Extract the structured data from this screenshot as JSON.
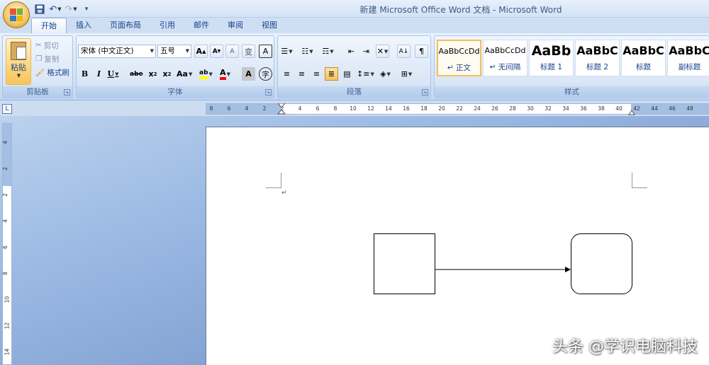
{
  "window": {
    "title": "新建 Microsoft Office Word 文档 - Microsoft Word"
  },
  "quick_access": {
    "icons": [
      "save-icon",
      "undo-icon",
      "redo-icon",
      "customize-icon"
    ]
  },
  "tabs": [
    {
      "label": "开始",
      "active": true
    },
    {
      "label": "插入"
    },
    {
      "label": "页面布局"
    },
    {
      "label": "引用"
    },
    {
      "label": "邮件"
    },
    {
      "label": "审阅"
    },
    {
      "label": "视图"
    }
  ],
  "clipboard": {
    "paste_label": "粘贴",
    "cut_label": "剪切",
    "copy_label": "复制",
    "format_painter_label": "格式刷",
    "group_label": "剪贴板"
  },
  "font": {
    "font_name": "宋体 (中文正文)",
    "font_size": "五号",
    "group_label": "字体",
    "buttons": {
      "grow": "A",
      "shrink": "A",
      "clear": "A",
      "phonetic": "变",
      "border": "A",
      "bold": "B",
      "italic": "I",
      "underline": "U",
      "strike": "abe",
      "subscript": "x",
      "superscript": "x",
      "case": "Aa",
      "highlight": "ab",
      "color": "A",
      "shading": "A",
      "enclose": "字"
    },
    "highlight_color": "#ffff00",
    "font_color": "#ff0000"
  },
  "paragraph": {
    "group_label": "段落"
  },
  "styles": {
    "group_label": "样式",
    "items": [
      {
        "sample": "AaBbCcDd",
        "name": "↵ 正文",
        "selected": true
      },
      {
        "sample": "AaBbCcDd",
        "name": "↵ 无间隔"
      },
      {
        "sample": "AaBb",
        "name": "标题 1"
      },
      {
        "sample": "AaBbC",
        "name": "标题 2"
      },
      {
        "sample": "AaBbC",
        "name": "标题"
      },
      {
        "sample": "AaBbC",
        "name": "副标题"
      }
    ]
  },
  "ruler": {
    "corner": "L",
    "h_ticks": [
      "8",
      "6",
      "4",
      "2",
      "2",
      "4",
      "6",
      "8",
      "10",
      "12",
      "14",
      "16",
      "18",
      "20",
      "22",
      "24",
      "26",
      "28",
      "30",
      "32",
      "34",
      "36",
      "38",
      "40",
      "42",
      "44",
      "46",
      "48"
    ],
    "v_ticks": [
      "4",
      "2",
      "2",
      "4",
      "6",
      "8",
      "10",
      "12",
      "14"
    ]
  },
  "document": {
    "paragraph_mark": "↵"
  },
  "watermark": "头条 @学识电脑科技",
  "colors": {
    "accent": "#15428b",
    "ribbon_bg": "#d3e2f4",
    "selected_style": "#f3be5b"
  }
}
